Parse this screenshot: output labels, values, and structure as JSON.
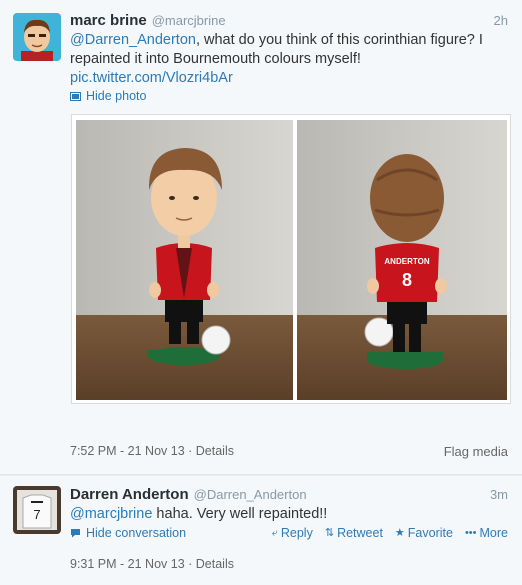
{
  "tweet1": {
    "name": "marc brine",
    "handle": "@marcjbrine",
    "time": "2h",
    "mention": "@Darren_Anderton",
    "text_line1": ", what do you think of this corinthian figure? I",
    "text_line2": "repainted it into Bournemouth colours myself!",
    "pic_link": "pic.twitter.com/Vlozri4bAr",
    "hide_photo": "Hide photo",
    "timestamp": "7:52 PM - 21 Nov 13",
    "details": "Details",
    "flag_media": "Flag media",
    "shirt_text": "ANDERTON",
    "shirt_number": "8"
  },
  "tweet2": {
    "name": "Darren Anderton",
    "handle": "@Darren_Anderton",
    "time": "3m",
    "mention": "@marcjbrine",
    "text": " haha. Very well repainted!!",
    "hide_conversation": "Hide conversation",
    "reply": "Reply",
    "retweet": "Retweet",
    "favorite": "Favorite",
    "more": "More",
    "timestamp": "9:31 PM - 21 Nov 13",
    "details": "Details"
  },
  "colors": {
    "link": "#2b7bb9",
    "shirt_red": "#c8141c",
    "shirt_black": "#111111",
    "base_green": "#1f6e3a"
  }
}
